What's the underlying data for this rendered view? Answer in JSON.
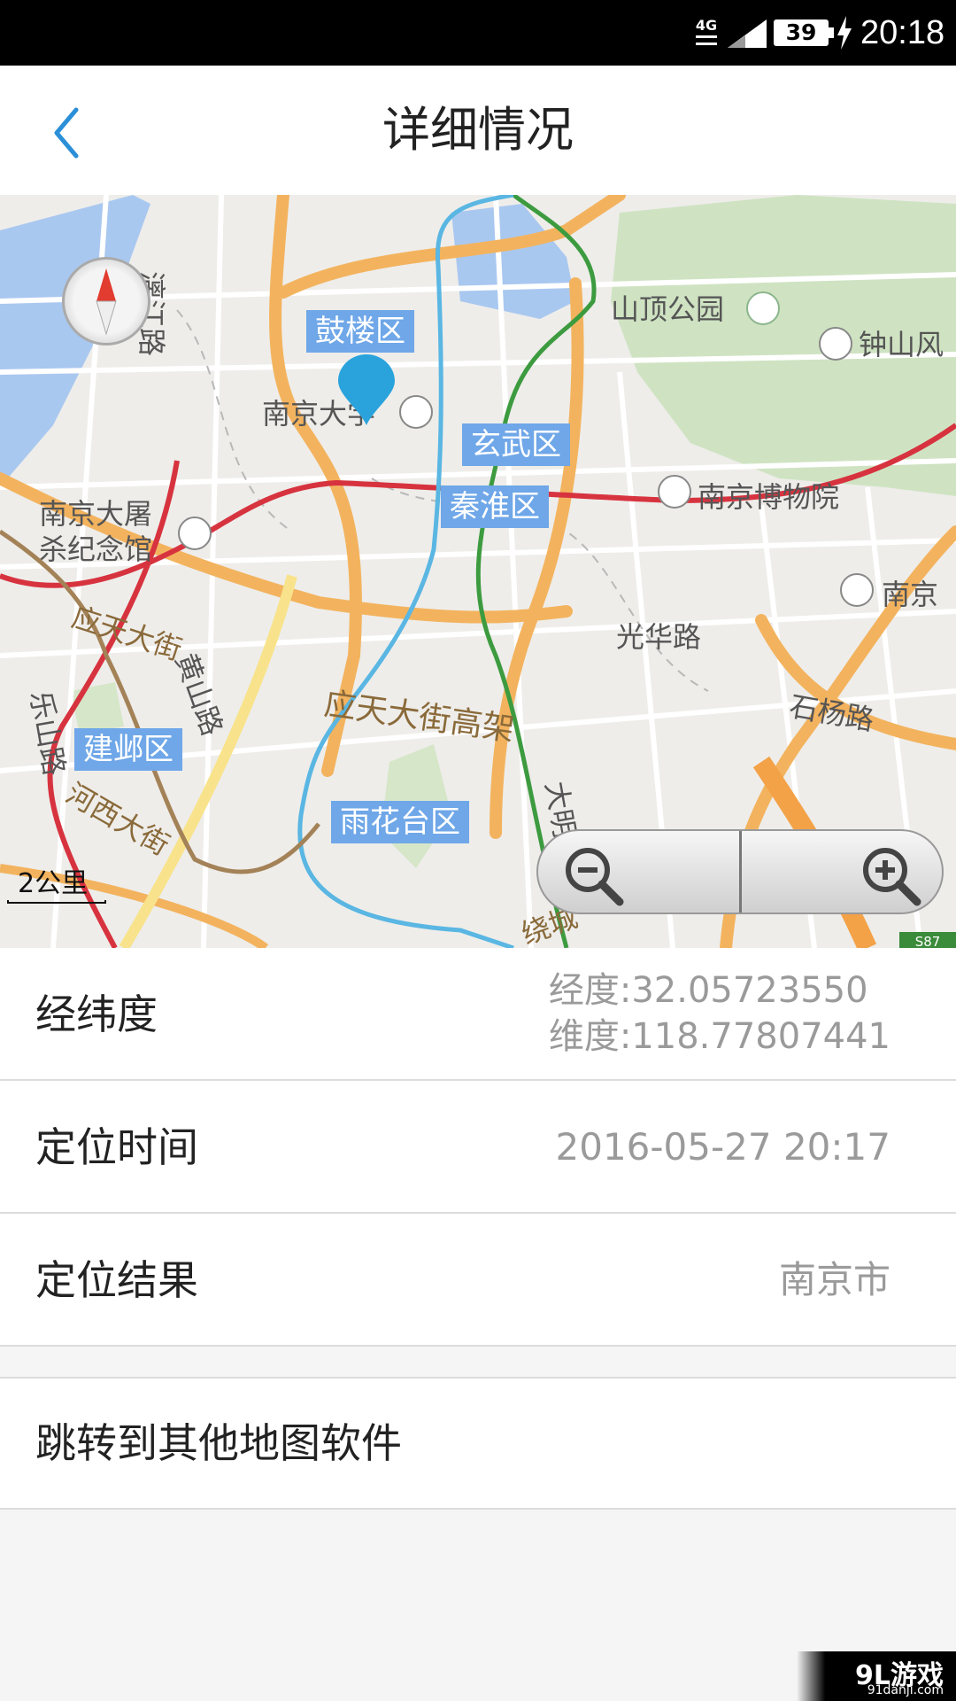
{
  "status_bar": {
    "network": "4G",
    "battery": "39",
    "time": "20:18"
  },
  "header": {
    "title": "详细情况"
  },
  "map": {
    "place_labels": [
      {
        "id": "shanding",
        "text": "山顶公园"
      },
      {
        "id": "zhongshan",
        "text": "钟山风"
      },
      {
        "id": "nju",
        "text": "南京大学"
      },
      {
        "id": "museum",
        "text": "南京博物院"
      },
      {
        "id": "memorial",
        "text": "南京大屠\n杀纪念馆"
      },
      {
        "id": "nanjing-r",
        "text": "南京"
      },
      {
        "id": "yingtian",
        "text": "应天大街"
      },
      {
        "id": "guanghua",
        "text": "光华路"
      },
      {
        "id": "shiyang",
        "text": "石杨路"
      },
      {
        "id": "yingtian-gj",
        "text": "应天大街高架"
      },
      {
        "id": "huangshan",
        "text": "黄山路"
      },
      {
        "id": "lejiang",
        "text": "乐山路"
      },
      {
        "id": "hexi",
        "text": "河西大街"
      },
      {
        "id": "lijiang",
        "text": "漓江路"
      },
      {
        "id": "daming",
        "text": "大明路"
      },
      {
        "id": "raocheng",
        "text": "绕城"
      }
    ],
    "districts": [
      {
        "id": "gulou",
        "text": "鼓楼区"
      },
      {
        "id": "xuanwu",
        "text": "玄武区"
      },
      {
        "id": "qinhuai",
        "text": "秦淮区"
      },
      {
        "id": "jianye",
        "text": "建邺区"
      },
      {
        "id": "yuhuatai",
        "text": "雨花台区"
      }
    ],
    "scale": "2公里",
    "road_sign": "S87",
    "colors": {
      "water": "#a9c8f0",
      "park": "#cfe3c2",
      "road": "#f3b35e",
      "district_badge": "#6fa7e8",
      "pin": "#2aa3dc"
    }
  },
  "details": {
    "coord_label": "经纬度",
    "latitude_text": "经度:32.05723550",
    "longitude_text": "维度:118.77807441",
    "time_label": "定位时间",
    "time_value": "2016-05-27 20:17",
    "result_label": "定位结果",
    "result_value": "南京市"
  },
  "actions": {
    "jump_label": "跳转到其他地图软件"
  },
  "watermark": {
    "main": "9L游戏",
    "sub": "91danji.com"
  }
}
